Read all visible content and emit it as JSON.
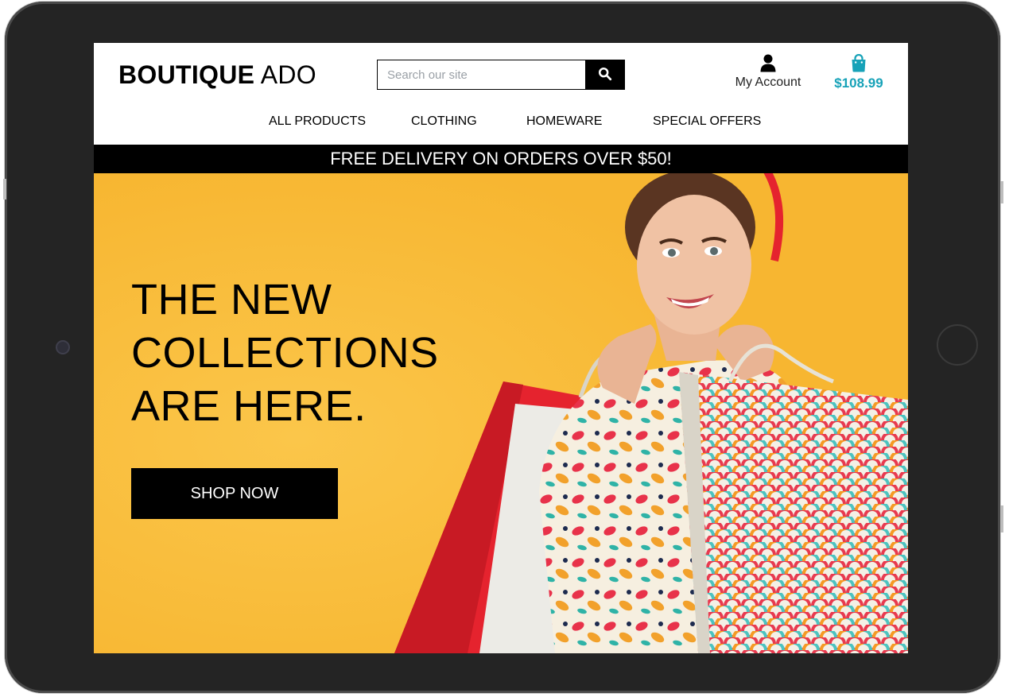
{
  "brand": {
    "name_bold": "BOUTIQUE",
    "name_light": "ADO"
  },
  "search": {
    "placeholder": "Search our site",
    "icon": "search-icon"
  },
  "account": {
    "label": "My Account",
    "icon": "user-icon"
  },
  "cart": {
    "total": "$108.99",
    "icon": "shopping-bag-icon"
  },
  "nav": {
    "items": [
      {
        "label": "ALL PRODUCTS"
      },
      {
        "label": "CLOTHING"
      },
      {
        "label": "HOMEWARE"
      },
      {
        "label": "SPECIAL OFFERS"
      }
    ]
  },
  "banner": {
    "text": "FREE DELIVERY ON ORDERS OVER $50!"
  },
  "hero": {
    "headline_lines": [
      "THE NEW",
      "COLLECTIONS",
      "ARE HERE."
    ],
    "cta_label": "SHOP NOW"
  },
  "colors": {
    "accent": "#17a2b8",
    "hero_background": "#f9be3c",
    "banner_background": "#000000",
    "device_frame": "#242424"
  }
}
